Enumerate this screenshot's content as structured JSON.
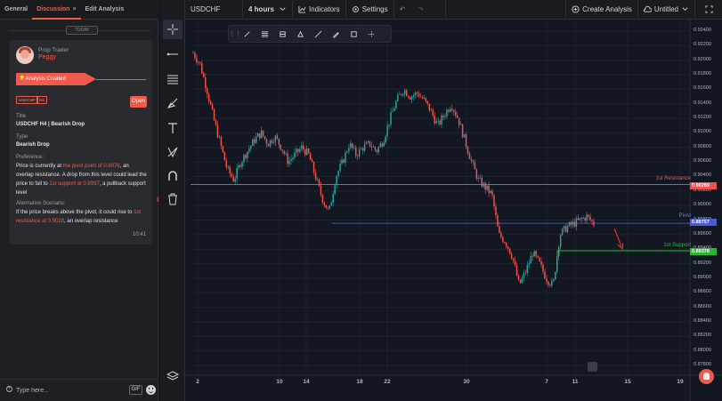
{
  "tabs": [
    {
      "label": "General"
    },
    {
      "label": "Discussion",
      "close": "×"
    },
    {
      "label": "Edit Analysis"
    }
  ],
  "today_label": "TODAY",
  "message": {
    "sender_role": "Prop Trader",
    "sender_name": "Peggy",
    "banner": "Analysis Created",
    "tags": [
      "USDCHF",
      "H4"
    ],
    "open_label": "Open",
    "title_label": "Title",
    "title_value": "USDCHF H4 | Bearish Drop",
    "type_label": "Type",
    "type_value": "Bearish Drop",
    "preference_label": "Preference:",
    "preference_parts": [
      "Price is currently at ",
      "the pivot point of 0.8976",
      ", an overlap resistance. A drop from this level could lead the price to fall to ",
      "1st support at 0.8937",
      ", a pullback support level"
    ],
    "alt_label": "Alternative Scenario:",
    "alt_parts": [
      "If the price breaks above the pivot, it could rise to ",
      "1st resistance at 0.9028",
      ", an overlap resistance"
    ],
    "time": "10:41"
  },
  "compose": {
    "placeholder": "Type here...",
    "gif_label": "GIF"
  },
  "toolbar": {
    "symbol": "USDCHF",
    "interval": "4 hours",
    "indicators": "Indicators",
    "settings": "Settings",
    "create_analysis": "Create Analysis",
    "layout_name": "Untitled"
  },
  "icons": {
    "tools": [
      "crosshair-icon",
      "horizontal-line-icon",
      "fib-tool-icon",
      "brush-icon",
      "text-icon",
      "pattern-icon",
      "magnet-icon",
      "trash-icon"
    ],
    "draw_tools": [
      "pen-icon",
      "align-icon",
      "fill-icon",
      "marker-icon",
      "line-icon",
      "pencil-icon",
      "rectangle-icon",
      "more-icon"
    ]
  },
  "colors": {
    "accent": "#f05a4b",
    "up": "#26a69a",
    "down": "#ef5350",
    "resistance": "#ef5350",
    "pivot": "#4c5bd4",
    "support": "#2bb534"
  },
  "chart_data": {
    "type": "candlestick",
    "symbol": "USDCHF",
    "interval": "4 hours",
    "ylim": [
      0.8768,
      0.9248
    ],
    "y_ticks": [
      "0.92400",
      "0.92200",
      "0.92000",
      "0.91800",
      "0.91600",
      "0.91400",
      "0.91200",
      "0.91000",
      "0.90800",
      "0.90600",
      "0.90400",
      "0.90200",
      "0.90000",
      "0.89800",
      "0.89600",
      "0.89400",
      "0.89200",
      "0.89000",
      "0.88800",
      "0.88600",
      "0.88400",
      "0.88200",
      "0.88000",
      "0.87800"
    ],
    "x_ticks": [
      "2",
      "10",
      "14",
      "18",
      "22",
      "30",
      "7",
      "11",
      "15",
      "19"
    ],
    "levels": [
      {
        "name": "1st Resistance",
        "value": 0.90289,
        "label": "0.90289"
      },
      {
        "name": "Pivot",
        "value": 0.89757,
        "label": "0.89757"
      },
      {
        "name": "1st Support",
        "value": 0.89378,
        "label": "0.89378"
      }
    ],
    "close_path": [
      [
        0,
        0.921
      ],
      [
        4,
        0.9195
      ],
      [
        8,
        0.916
      ],
      [
        12,
        0.912
      ],
      [
        16,
        0.9085
      ],
      [
        20,
        0.905
      ],
      [
        24,
        0.9035
      ],
      [
        28,
        0.906
      ],
      [
        32,
        0.9075
      ],
      [
        36,
        0.909
      ],
      [
        40,
        0.91
      ],
      [
        44,
        0.9085
      ],
      [
        48,
        0.9095
      ],
      [
        52,
        0.908
      ],
      [
        56,
        0.906
      ],
      [
        60,
        0.907
      ],
      [
        64,
        0.908
      ],
      [
        68,
        0.907
      ],
      [
        72,
        0.904
      ],
      [
        76,
        0.901
      ],
      [
        80,
        0.899
      ],
      [
        84,
        0.904
      ],
      [
        88,
        0.906
      ],
      [
        92,
        0.9085
      ],
      [
        96,
        0.907
      ],
      [
        100,
        0.908
      ],
      [
        104,
        0.9085
      ],
      [
        108,
        0.9075
      ],
      [
        112,
        0.909
      ],
      [
        116,
        0.912
      ],
      [
        120,
        0.9145
      ],
      [
        124,
        0.916
      ],
      [
        128,
        0.915
      ],
      [
        132,
        0.9155
      ],
      [
        136,
        0.9145
      ],
      [
        140,
        0.913
      ],
      [
        144,
        0.911
      ],
      [
        148,
        0.9125
      ],
      [
        152,
        0.914
      ],
      [
        156,
        0.912
      ],
      [
        160,
        0.909
      ],
      [
        164,
        0.906
      ],
      [
        168,
        0.9035
      ],
      [
        172,
        0.9025
      ],
      [
        176,
        0.9015
      ],
      [
        180,
        0.896
      ],
      [
        184,
        0.895
      ],
      [
        188,
        0.893
      ],
      [
        192,
        0.889
      ],
      [
        196,
        0.891
      ],
      [
        200,
        0.8935
      ],
      [
        204,
        0.892
      ],
      [
        208,
        0.89
      ],
      [
        212,
        0.889
      ],
      [
        216,
        0.896
      ],
      [
        220,
        0.897
      ],
      [
        224,
        0.8975
      ],
      [
        228,
        0.898
      ],
      [
        232,
        0.8985
      ],
      [
        236,
        0.8975
      ]
    ],
    "grid": true
  }
}
